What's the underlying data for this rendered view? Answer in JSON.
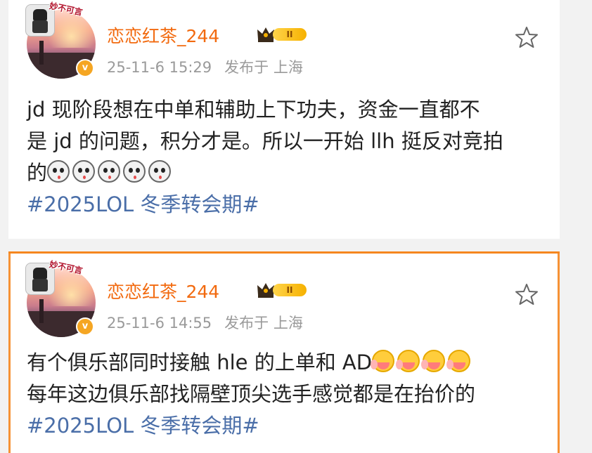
{
  "posts": [
    {
      "username": "恋恋红茶_244",
      "vip_label": "II",
      "date": "25-11-6 15:29",
      "location": "发布于 上海",
      "lines": [
        "jd 现阶段想在中单和辅助上下功夫，资金一直都不",
        "是 jd 的问题，积分才是。所以一开始 llh 挺反对竞拍",
        "的"
      ],
      "emoji_count": 5,
      "emoji_name": "snowman-shocked-emoji",
      "hashtag": "#2025LOL 冬季转会期#",
      "avatar_text": "妙不可言",
      "verified_badge": "v"
    },
    {
      "username": "恋恋红茶_244",
      "vip_label": "II",
      "date": "25-11-6 14:55",
      "location": "发布于 上海",
      "lines": [
        "有个俱乐部同时接触 hle 的上单和 AD",
        "每年这边俱乐部找隔壁顶尖选手感觉都是在抬价的"
      ],
      "emoji_count": 4,
      "emoji_name": "yummy-face-emoji",
      "hashtag": "#2025LOL 冬季转会期#",
      "avatar_text": "妙不可言",
      "verified_badge": "v"
    }
  ],
  "colors": {
    "accent": "#f26a0f",
    "hashtag": "#4a6ea8",
    "meta": "#9a9a9a",
    "orange_border": "#f5861f"
  }
}
